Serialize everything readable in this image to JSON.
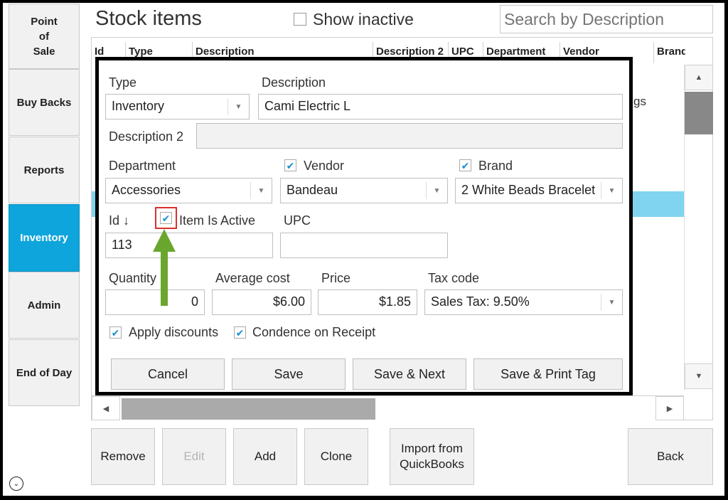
{
  "nav": {
    "point_of_sale": "Point\nof\nSale",
    "buy_backs": "Buy Backs",
    "reports": "Reports",
    "inventory": "Inventory",
    "admin": "Admin",
    "end_of_day": "End of Day"
  },
  "header": {
    "title": "Stock items",
    "show_inactive": "Show inactive",
    "search_placeholder": "Search by Description"
  },
  "grid": {
    "columns": [
      "Id",
      "Type",
      "Description",
      "Description 2",
      "UPC",
      "Department",
      "Vendor",
      "Brand"
    ],
    "partial_text": "gs"
  },
  "dialog": {
    "type_label": "Type",
    "type_value": "Inventory",
    "description_label": "Description",
    "description_value": "Cami Electric L",
    "description2_label": "Description 2",
    "description2_value": "",
    "department_label": "Department",
    "department_value": "Accessories",
    "vendor_label": "Vendor",
    "vendor_value": "Bandeau",
    "brand_label": "Brand",
    "brand_value": "2 White Beads Bracelet",
    "id_label": "Id ↓",
    "id_value": "113",
    "item_active_label": "Item Is Active",
    "upc_label": "UPC",
    "upc_value": "",
    "quantity_label": "Quantity",
    "quantity_value": "0",
    "avg_cost_label": "Average cost",
    "avg_cost_value": "$6.00",
    "price_label": "Price",
    "price_value": "$1.85",
    "tax_label": "Tax code",
    "tax_value": "Sales Tax: 9.50%",
    "apply_discounts_label": "Apply discounts",
    "condence_label": "Condence on Receipt",
    "cancel": "Cancel",
    "save": "Save",
    "save_next": "Save & Next",
    "save_print": "Save & Print Tag"
  },
  "bottom": {
    "remove": "Remove",
    "edit": "Edit",
    "add": "Add",
    "clone": "Clone",
    "import": "Import from\nQuickBooks",
    "back": "Back"
  },
  "colors": {
    "accent": "#0ea5dc",
    "row_highlight": "#80d4f0",
    "callout_arrow": "#6aa62e",
    "callout_box": "#d9312f"
  },
  "icons": {
    "checkbox_checked": "✔",
    "dropdown": "▼",
    "scroll_up": "▲",
    "scroll_down": "▼",
    "scroll_left": "◀",
    "scroll_right": "▶",
    "expand": "⌄"
  }
}
